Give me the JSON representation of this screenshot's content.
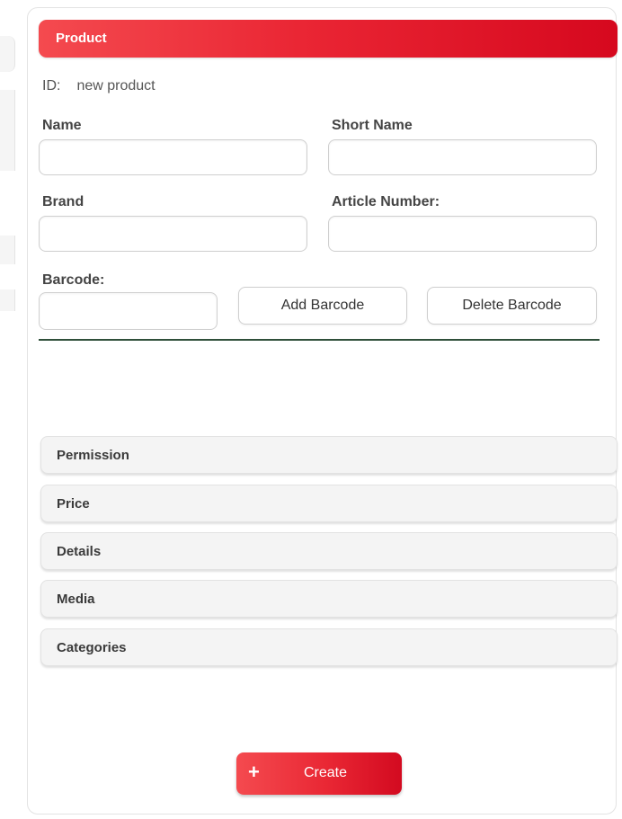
{
  "panel": {
    "title": "Product"
  },
  "id_row": {
    "label": "ID:",
    "value": "new product"
  },
  "form": {
    "name_label": "Name",
    "name_value": "",
    "short_name_label": "Short Name",
    "short_name_value": "",
    "brand_label": "Brand",
    "brand_value": "",
    "article_number_label": "Article Number:",
    "article_number_value": "",
    "barcode_label": "Barcode:",
    "barcode_value": "",
    "add_barcode_label": "Add Barcode",
    "delete_barcode_label": "Delete Barcode"
  },
  "accordion": {
    "items": [
      {
        "label": "Permission"
      },
      {
        "label": "Price"
      },
      {
        "label": "Details"
      },
      {
        "label": "Media"
      },
      {
        "label": "Categories"
      }
    ]
  },
  "actions": {
    "create_icon": "plus-icon",
    "create_label": "Create"
  },
  "colors": {
    "accent": "#e92734",
    "divider": "#2f4f3a"
  }
}
